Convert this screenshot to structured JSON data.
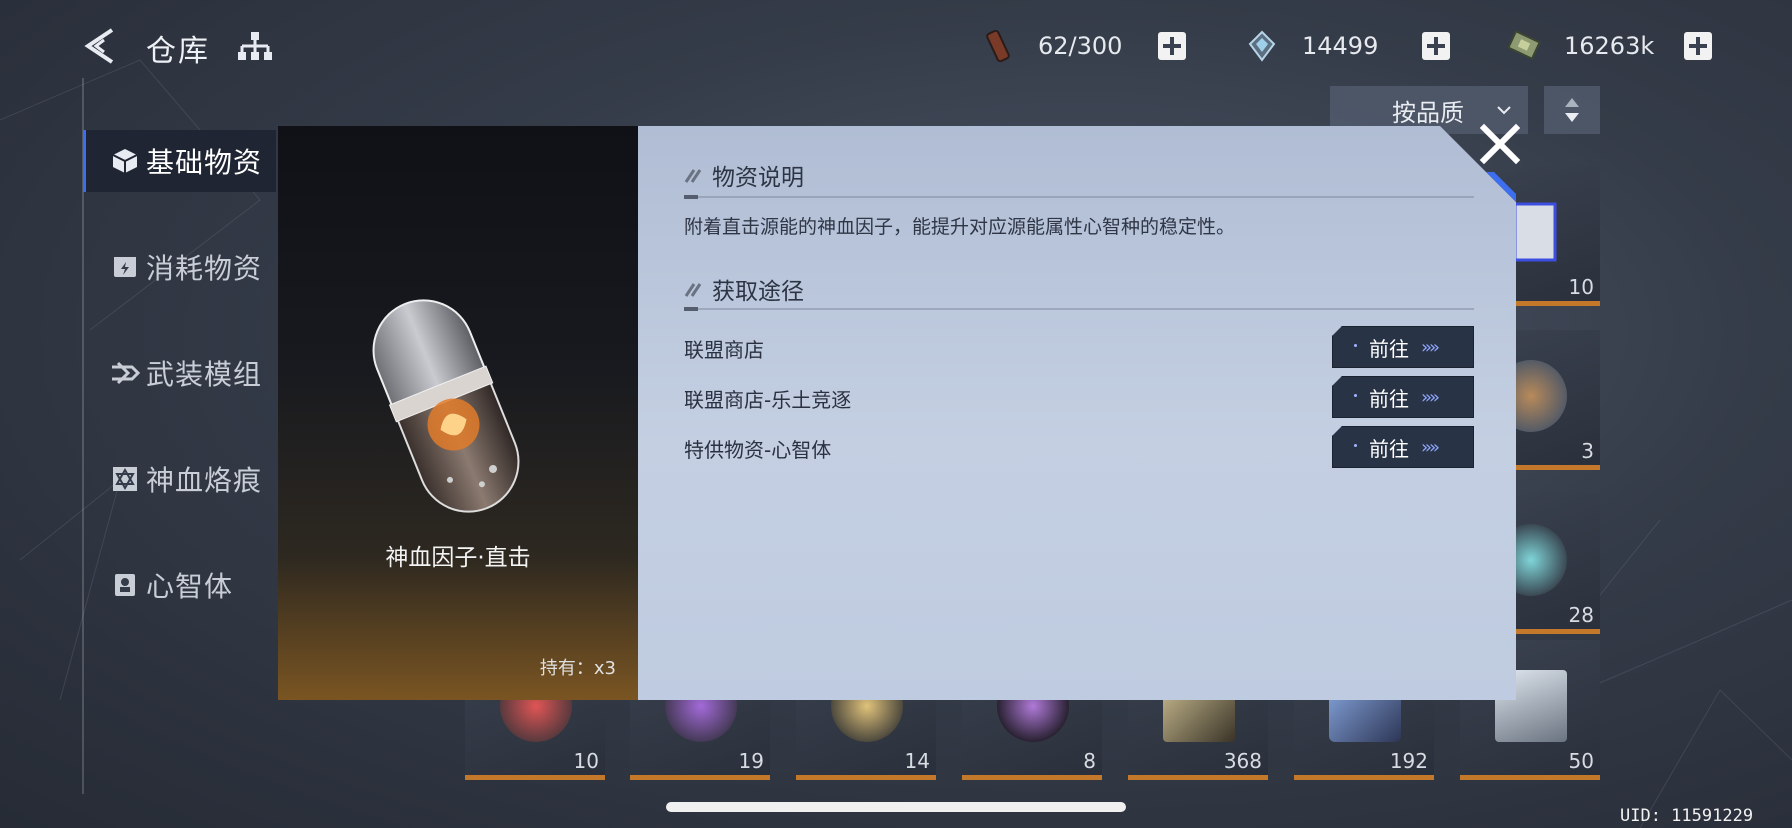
{
  "header": {
    "title": "仓库",
    "resources": [
      {
        "icon": "stamina-vial-icon",
        "value": "62/300"
      },
      {
        "icon": "crystal-icon",
        "value": "14499"
      },
      {
        "icon": "currency-notes-icon",
        "value": "16263k"
      }
    ]
  },
  "sidebar": {
    "items": [
      {
        "label": "基础物资",
        "icon": "cube-icon",
        "active": true
      },
      {
        "label": "消耗物资",
        "icon": "lightning-box-icon",
        "active": false
      },
      {
        "label": "武装模组",
        "icon": "armament-icon",
        "active": false
      },
      {
        "label": "神血烙痕",
        "icon": "hexagram-icon",
        "active": false
      },
      {
        "label": "心智体",
        "icon": "mind-card-icon",
        "active": false
      }
    ]
  },
  "sort": {
    "label": "按品质"
  },
  "inventory": {
    "right_column_counts": [
      "10",
      "3",
      "28"
    ],
    "bottom_row_counts": [
      "10",
      "19",
      "14",
      "8",
      "368",
      "192",
      "50"
    ]
  },
  "modal": {
    "item_name": "神血因子·直击",
    "holding": "持有：x3",
    "description_title": "物资说明",
    "description": "附着直击源能的神血因子，能提升对应源能属性心智种的稳定性。",
    "sources_title": "获取途径",
    "sources": [
      {
        "label": "联盟商店",
        "button": "前往"
      },
      {
        "label": "联盟商店-乐土竞逐",
        "button": "前往"
      },
      {
        "label": "特供物资-心智体",
        "button": "前往"
      }
    ]
  },
  "footer": {
    "uid": "UID: 11591229"
  },
  "colors": {
    "accent": "#3d6ef0",
    "rarity_orange": "#c4782a",
    "button_dark": "#293346"
  }
}
